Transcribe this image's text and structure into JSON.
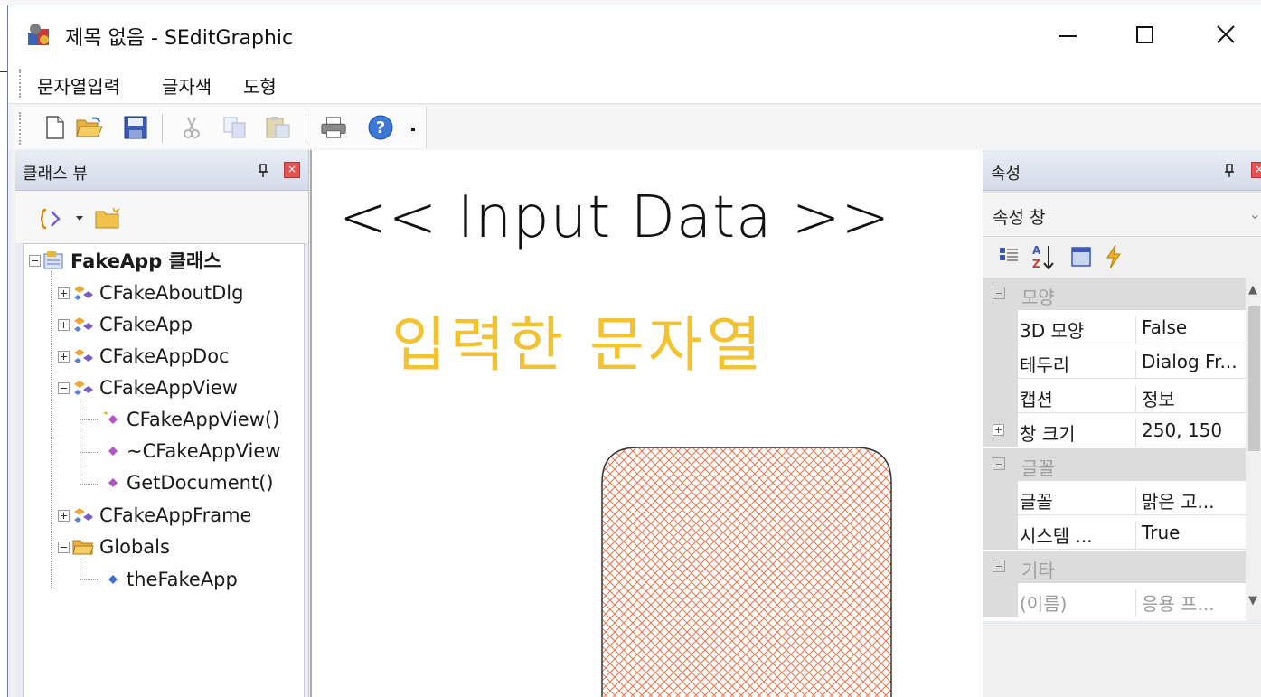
{
  "window": {
    "title": "제목 없음 - SEditGraphic",
    "buttons": {
      "minimize": "minimize",
      "maximize": "maximize",
      "close": "close"
    }
  },
  "menu": {
    "items": [
      "문자열입력",
      "글자색",
      "도형"
    ]
  },
  "toolbar": {
    "buttons": [
      "new-icon",
      "open-icon",
      "save-icon",
      "cut-icon",
      "copy-icon",
      "paste-icon",
      "print-icon",
      "help-icon"
    ]
  },
  "class_view": {
    "title": "클래스 뷰",
    "tree": [
      {
        "label": "FakeApp 클래스",
        "bold": true
      },
      {
        "label": "CFakeAboutDlg"
      },
      {
        "label": "CFakeApp"
      },
      {
        "label": "CFakeAppDoc"
      },
      {
        "label": "CFakeAppView"
      },
      {
        "label": "CFakeAppView()"
      },
      {
        "label": "~CFakeAppView"
      },
      {
        "label": "GetDocument()"
      },
      {
        "label": "CFakeAppFrame"
      },
      {
        "label": "Globals"
      },
      {
        "label": "theFakeApp"
      }
    ]
  },
  "canvas": {
    "heading": "<< Input Data >>",
    "input_string": "입력한 문자열",
    "text_color": "#f2c230",
    "shape": {
      "type": "rounded-rectangle",
      "fill": "cross-hatch",
      "hatch_color": "#e8734a"
    }
  },
  "properties": {
    "title": "속성",
    "selector": "속성 창",
    "categories": [
      {
        "name": "모양",
        "rows": [
          {
            "name": "3D 모양",
            "value": "False"
          },
          {
            "name": "테두리",
            "value": "Dialog Fr..."
          },
          {
            "name": "캡션",
            "value": "정보"
          },
          {
            "name": "창 크기",
            "value": "250, 150",
            "expandable": true
          }
        ]
      },
      {
        "name": "글꼴",
        "rows": [
          {
            "name": "글꼴",
            "value": "맑은 고..."
          },
          {
            "name": "시스템 ...",
            "value": "True"
          }
        ]
      },
      {
        "name": "기타",
        "rows": [
          {
            "name": "(이름)",
            "value": "응용 프..."
          }
        ]
      }
    ]
  }
}
